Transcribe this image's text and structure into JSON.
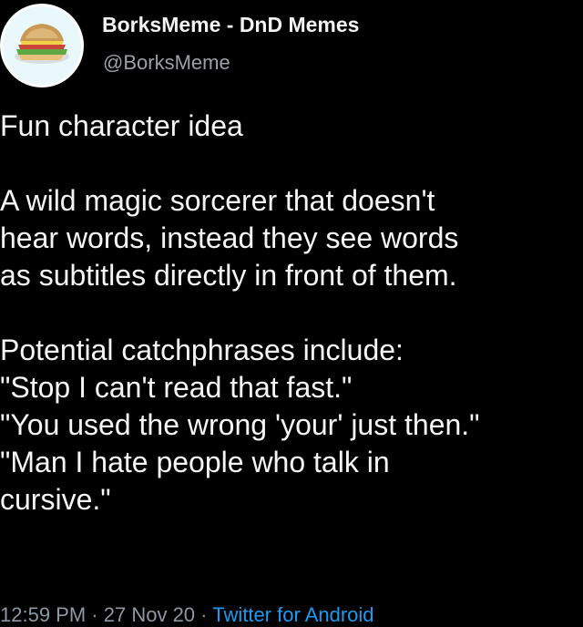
{
  "tweet": {
    "author": {
      "display_name": "BorksMeme - DnD Memes",
      "handle": "@BorksMeme",
      "avatar_icon": "sandwich-icon"
    },
    "text_lines": [
      "Fun character idea",
      "",
      "A wild magic sorcerer that doesn't",
      "hear words, instead they see words",
      "as subtitles directly in front of them.",
      "",
      "Potential catchphrases include:",
      "\"Stop I can't read that fast.\"",
      "\"You used the wrong 'your' just then.\"",
      "\"Man I hate people who talk in",
      "cursive.\""
    ],
    "time": "12:59 PM",
    "date": "27 Nov 20",
    "separator": "·",
    "source": "Twitter for Android"
  },
  "colors": {
    "background": "#000000",
    "text": "#f5f5f5",
    "secondary_text": "#8b98a5",
    "link": "#1d9bf0",
    "avatar_ring": "#e9f8fb"
  }
}
